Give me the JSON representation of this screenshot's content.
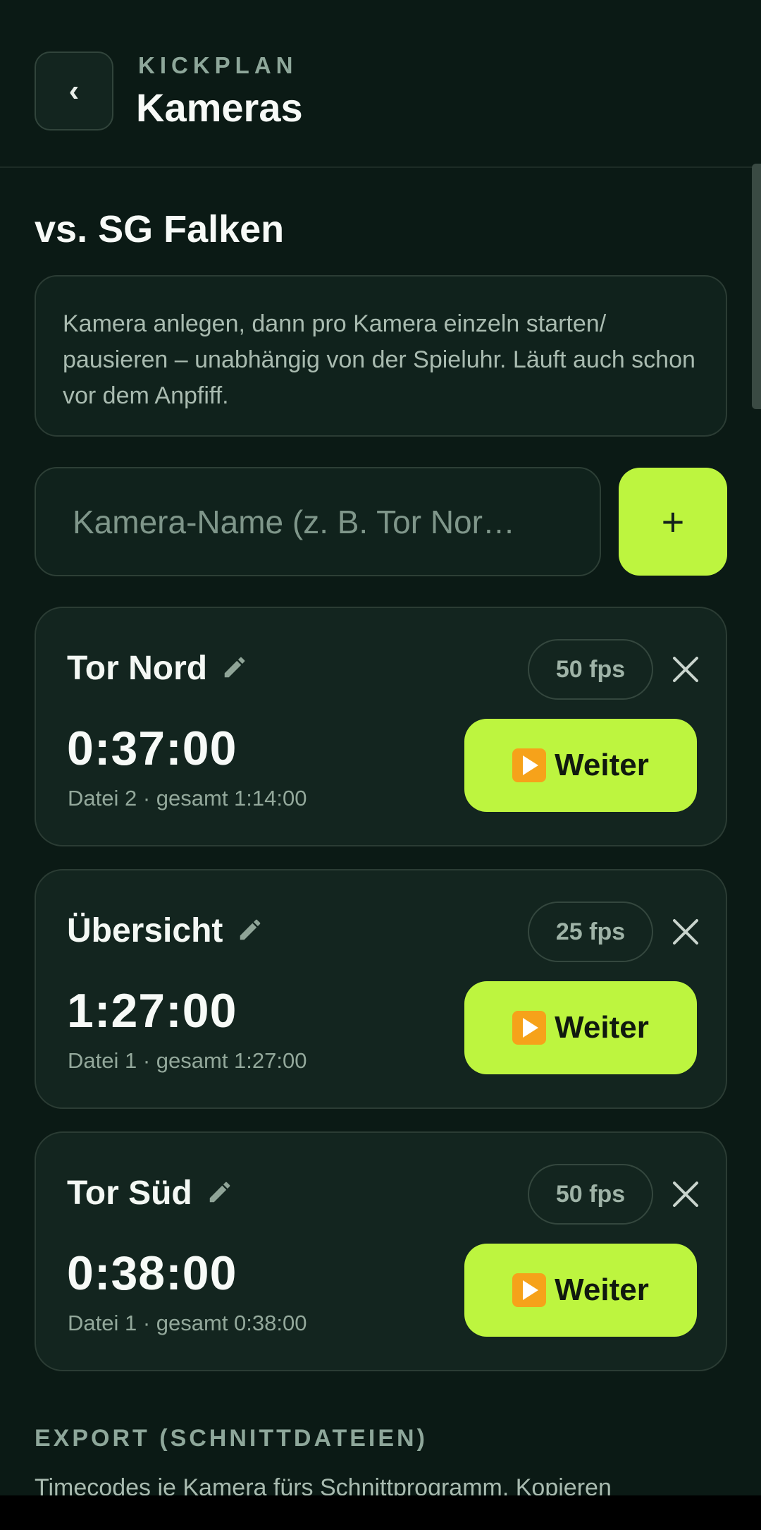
{
  "header": {
    "back_icon": "chevron-left-icon",
    "back_glyph": "‹",
    "app_name": "KICKPLAN",
    "title": "Kameras"
  },
  "match": {
    "title": "vs. SG Falken"
  },
  "info": {
    "text": "Kamera anlegen, dann pro Kamera einzeln starten/ pausieren – unabhängig von der Spieluhr. Läuft auch schon vor dem Anpfiff."
  },
  "add_camera": {
    "placeholder": "Kamera-Name (z. B. Tor Nor…",
    "value": "",
    "add_glyph": "+"
  },
  "cameras": [
    {
      "name": "Tor Nord",
      "fps": "50 fps",
      "time": "0:37:00",
      "meta": "Datei 2 · gesamt 1:14:00",
      "action": "Weiter"
    },
    {
      "name": "Übersicht",
      "fps": "25 fps",
      "time": "1:27:00",
      "meta": "Datei 1 · gesamt 1:27:00",
      "action": "Weiter"
    },
    {
      "name": "Tor Süd",
      "fps": "50 fps",
      "time": "0:38:00",
      "meta": "Datei 1 · gesamt 0:38:00",
      "action": "Weiter"
    }
  ],
  "export": {
    "heading": "EXPORT (SCHNITTDATEIEN)",
    "description": "Timecodes je Kamera fürs Schnittprogramm. Kopieren"
  },
  "colors": {
    "background": "#0b1a15",
    "card": "#13251f",
    "accent": "#bdf53f",
    "muted_text": "#93a89b"
  },
  "icons": {
    "edit": "pencil-icon",
    "remove": "close-icon",
    "play": "play-icon",
    "add": "plus-icon"
  }
}
